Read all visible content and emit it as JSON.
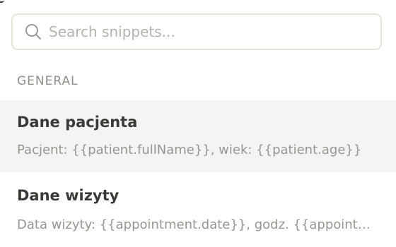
{
  "search": {
    "placeholder": "Search snippets...",
    "value": ""
  },
  "section": {
    "label": "GENERAL"
  },
  "snippets": [
    {
      "title": "Dane pacjenta",
      "preview": "Pacjent: {{patient.fullName}}, wiek: {{patient.age}}"
    },
    {
      "title": "Dane wizyty",
      "preview": "Data wizyty: {{appointment.date}}, godz. {{appointment.time}}"
    }
  ],
  "colors": {
    "active_row": "#f4f4f4",
    "border": "#e4e4d8",
    "title_text": "#3a3a36",
    "muted_text": "#969690"
  },
  "icons": {
    "search": "search-icon"
  }
}
